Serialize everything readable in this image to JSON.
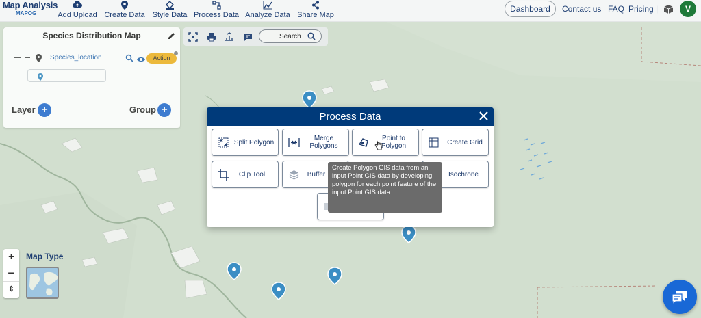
{
  "brand": {
    "title": "Map Analysis",
    "subtitle": "MAPOG"
  },
  "nav": [
    {
      "label": "Add Upload",
      "icon": "cloud-upload-icon"
    },
    {
      "label": "Create Data",
      "icon": "location-pin-icon"
    },
    {
      "label": "Style Data",
      "icon": "paint-bucket-icon"
    },
    {
      "label": "Process Data",
      "icon": "process-icon"
    },
    {
      "label": "Analyze Data",
      "icon": "analyze-icon"
    },
    {
      "label": "Share Map",
      "icon": "share-icon"
    }
  ],
  "header_right": {
    "dashboard": "Dashboard",
    "contact": "Contact us",
    "faq": "FAQ",
    "pricing": "Pricing |",
    "avatar_initial": "V"
  },
  "layer_panel": {
    "title": "Species Distribution Map",
    "layer_name": "Species_location",
    "action_label": "Action",
    "layer_label": "Layer",
    "group_label": "Group"
  },
  "toolbar": {
    "search_label": "Search"
  },
  "map_controls": {
    "zoom_in": "+",
    "zoom_out": "−",
    "reset": "⇕",
    "map_type_label": "Map Type"
  },
  "modal": {
    "title": "Process Data",
    "tools": [
      {
        "label": "Split Polygon",
        "icon": "split-polygon-icon"
      },
      {
        "label": "Merge Polygons",
        "icon": "merge-polygons-icon"
      },
      {
        "label": "Point to Polygon",
        "icon": "point-to-polygon-icon"
      },
      {
        "label": "Create Grid",
        "icon": "grid-icon"
      },
      {
        "label": "Clip Tool",
        "icon": "crop-icon"
      },
      {
        "label": "Buffer",
        "icon": "layers-icon"
      },
      {
        "label": "Isochrone",
        "icon": "isochrone-icon"
      }
    ],
    "tooltip": "Create Polygon GIS data from an input Point GIS data by developing polygon for each point feature of the input Point GIS data."
  },
  "colors": {
    "brand_navy": "#003a7a",
    "accent_blue": "#2a6fd1",
    "action_yellow": "#f0b428",
    "map_land": "#d2dfcf",
    "marker": "#3b8ec4",
    "avatar_green": "#1f7a3a"
  }
}
